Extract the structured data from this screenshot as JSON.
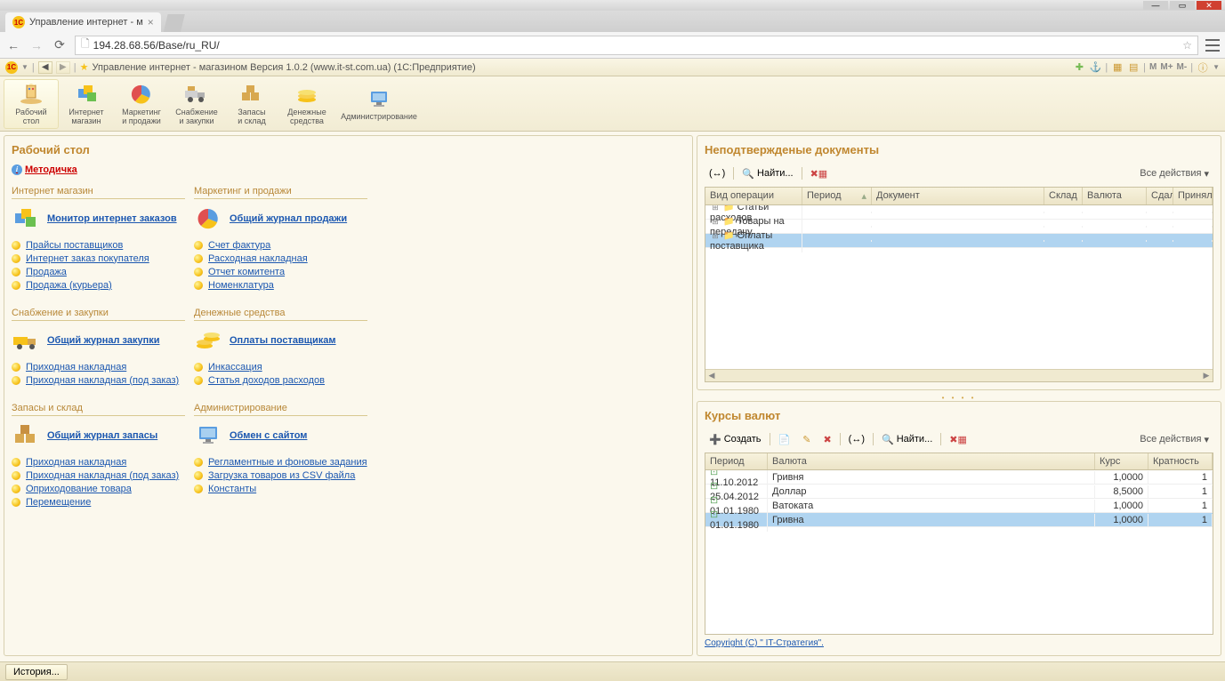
{
  "browser": {
    "tab_title": "Управление интернет - м",
    "url": "194.28.68.56/Base/ru_RU/"
  },
  "app": {
    "title": "Управление интернет - магазином Версия 1.0.2 (www.it-st.com.ua) (1С:Предприятие)",
    "m_labels": [
      "M",
      "M+",
      "M-"
    ]
  },
  "sections": [
    {
      "id": "desktop",
      "line1": "Рабочий",
      "line2": "стол",
      "active": true
    },
    {
      "id": "shop",
      "line1": "Интернет",
      "line2": "магазин"
    },
    {
      "id": "marketing",
      "line1": "Маркетинг",
      "line2": "и продажи"
    },
    {
      "id": "supply",
      "line1": "Снабжение",
      "line2": "и закупки"
    },
    {
      "id": "stock",
      "line1": "Запасы",
      "line2": "и склад"
    },
    {
      "id": "money",
      "line1": "Денежные",
      "line2": "средства"
    },
    {
      "id": "admin",
      "line1": "Администрирование",
      "line2": ""
    }
  ],
  "desktop": {
    "title": "Рабочий стол",
    "methodichka": "Методичка",
    "blocks": [
      {
        "header": "Интернет магазин",
        "main": "Монитор интернет заказов",
        "icon": "cube",
        "links": [
          "Прайсы поставщиков",
          "Интернет заказ покупателя",
          "Продажа",
          "Продажа (курьера)"
        ]
      },
      {
        "header": "Маркетинг и продажи",
        "main": "Общий журнал продажи",
        "icon": "pie",
        "links": [
          "Счет фактура",
          "Расходная накладная",
          "Отчет комитента",
          "Номенклатура"
        ]
      },
      {
        "header": "Снабжение и закупки",
        "main": "Общий журнал закупки",
        "icon": "truck",
        "links": [
          "Приходная накладная",
          "Приходная накладная (под заказ)"
        ]
      },
      {
        "header": "Денежные средства",
        "main": "Оплаты поставщикам",
        "icon": "coins",
        "links": [
          "Инкассация",
          "Статья доходов расходов"
        ]
      },
      {
        "header": "Запасы и склад",
        "main": "Общий журнал запасы",
        "icon": "boxes",
        "links": [
          "Приходная накладная",
          "Приходная накладная (под заказ)",
          "Оприходование товара",
          "Перемещение"
        ]
      },
      {
        "header": "Администрирование",
        "main": "Обмен с сайтом",
        "icon": "monitor",
        "links": [
          "Регламентные и фоновые задания",
          "Загрузка товаров из CSV файла",
          "Константы"
        ]
      }
    ]
  },
  "unconfirmed": {
    "title": "Неподтвержденые документы",
    "find_label": "Найти...",
    "all_actions": "Все действия",
    "columns": [
      "Вид операции",
      "Период",
      "Документ",
      "Склад",
      "Валюта",
      "Сдал",
      "Принял"
    ],
    "rows": [
      {
        "op": "Статьи расходов"
      },
      {
        "op": "Товары на передачу"
      },
      {
        "op": "Оплаты поставщика",
        "selected": true
      }
    ]
  },
  "rates": {
    "title": "Курсы валют",
    "create_label": "Создать",
    "find_label": "Найти...",
    "all_actions": "Все действия",
    "columns": [
      "Период",
      "Валюта",
      "Курс",
      "Кратность"
    ],
    "rows": [
      {
        "period": "11.10.2012",
        "currency": "Гривня",
        "rate": "1,0000",
        "mult": "1"
      },
      {
        "period": "25.04.2012",
        "currency": "Доллар",
        "rate": "8,5000",
        "mult": "1"
      },
      {
        "period": "01.01.1980",
        "currency": "Ватоката",
        "rate": "1,0000",
        "mult": "1"
      },
      {
        "period": "01.01.1980",
        "currency": "Гривна",
        "rate": "1,0000",
        "mult": "1",
        "selected": true
      }
    ],
    "copyright": "Copyright (C) \" IT-Стратегия\"."
  },
  "bottom": {
    "history": "История..."
  }
}
